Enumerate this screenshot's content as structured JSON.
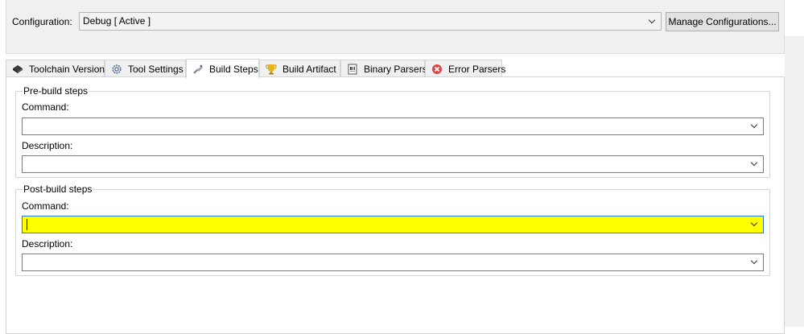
{
  "configuration": {
    "label": "Configuration:",
    "value": "Debug  [ Active ]",
    "manage_button": "Manage Configurations..."
  },
  "tabs": [
    {
      "label": "Toolchain Version",
      "icon": "chip-icon",
      "active": false
    },
    {
      "label": "Tool Settings",
      "icon": "settings-gear-icon",
      "active": false
    },
    {
      "label": "Build Steps",
      "icon": "build-steps-icon",
      "active": true
    },
    {
      "label": "Build Artifact",
      "icon": "trophy-icon",
      "active": false
    },
    {
      "label": "Binary Parsers",
      "icon": "binary-file-icon",
      "active": false
    },
    {
      "label": "Error Parsers",
      "icon": "error-icon",
      "active": false
    }
  ],
  "pre_build": {
    "title": "Pre-build steps",
    "command_label": "Command:",
    "command_value": "",
    "description_label": "Description:",
    "description_value": ""
  },
  "post_build": {
    "title": "Post-build steps",
    "command_label": "Command:",
    "command_value": "",
    "description_label": "Description:",
    "description_value": ""
  },
  "colors": {
    "highlight": "#ffff00",
    "focus_border": "#2b78c5",
    "error_icon": "#e04343",
    "trophy_icon": "#e8b31a"
  }
}
